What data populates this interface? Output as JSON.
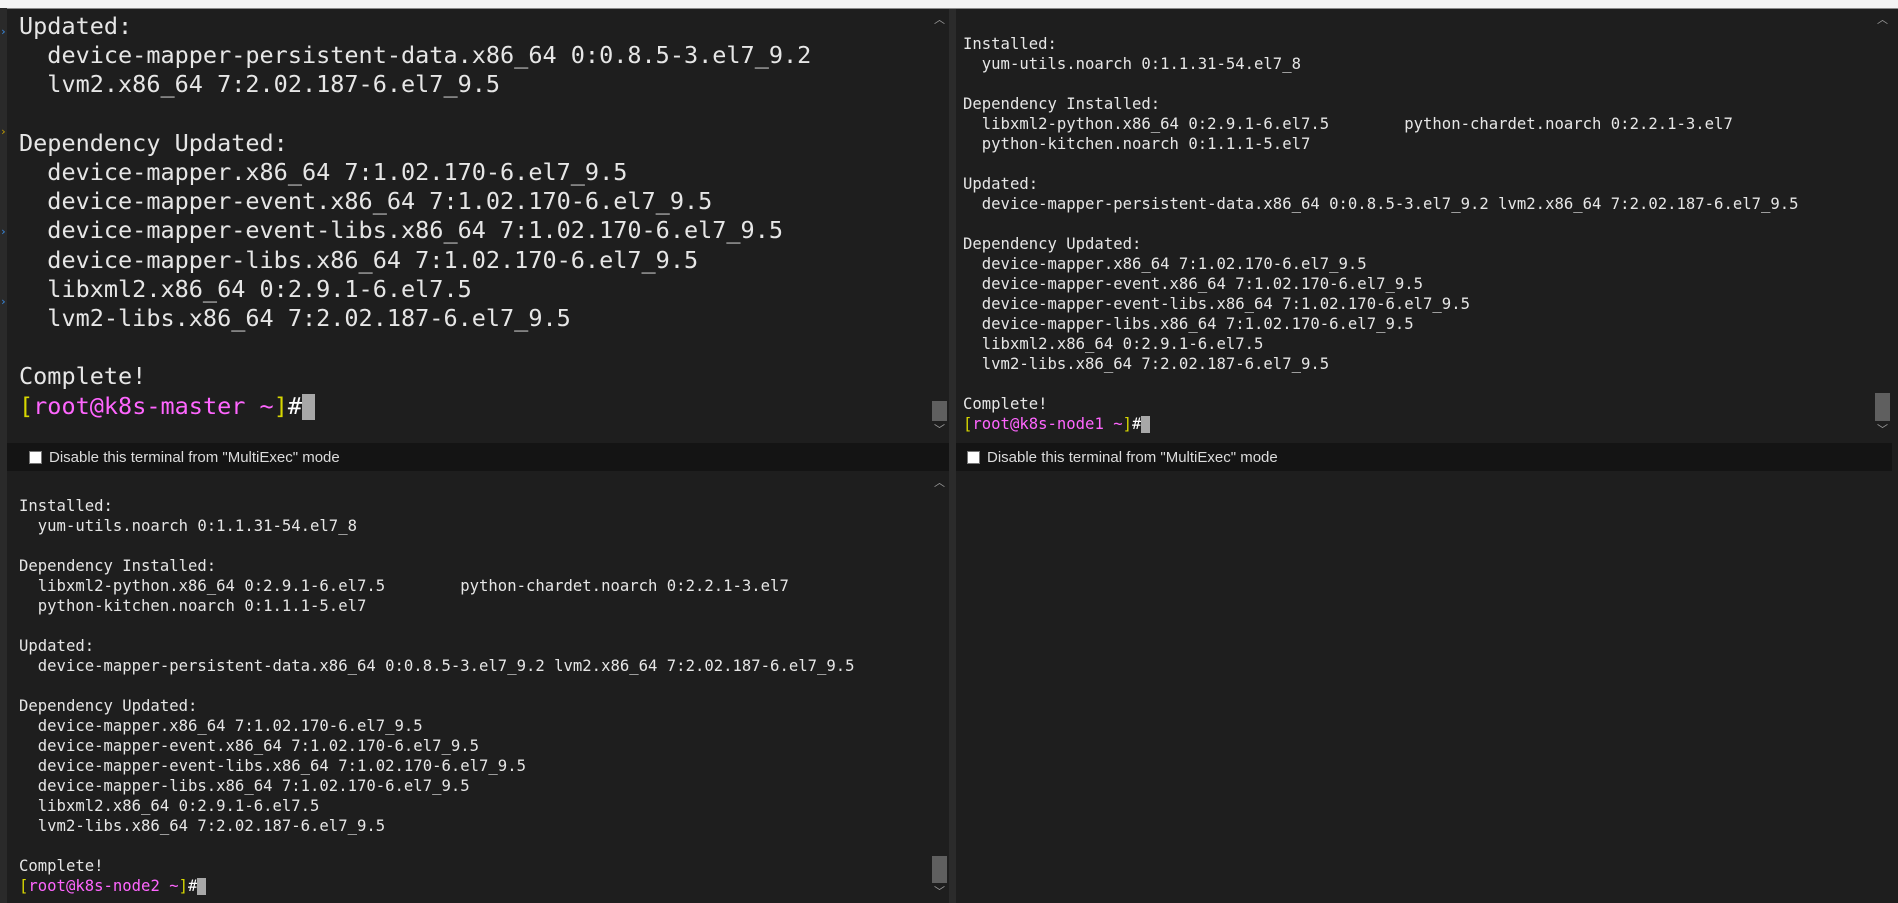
{
  "multiexec_label": "Disable this terminal from \"MultiExec\" mode",
  "panes": {
    "master": {
      "lines": [
        "Updated:",
        "  device-mapper-persistent-data.x86_64 0:0.8.5-3.el7_9.2",
        "  lvm2.x86_64 7:2.02.187-6.el7_9.5",
        "",
        "Dependency Updated:",
        "  device-mapper.x86_64 7:1.02.170-6.el7_9.5",
        "  device-mapper-event.x86_64 7:1.02.170-6.el7_9.5",
        "  device-mapper-event-libs.x86_64 7:1.02.170-6.el7_9.5",
        "  device-mapper-libs.x86_64 7:1.02.170-6.el7_9.5",
        "  libxml2.x86_64 0:2.9.1-6.el7.5",
        "  lvm2-libs.x86_64 7:2.02.187-6.el7_9.5",
        "",
        "Complete!"
      ],
      "prompt": {
        "open": "[",
        "user": "root",
        "at": "@",
        "host": "k8s-master",
        "tilde": " ~",
        "close": "]",
        "hash": "#"
      }
    },
    "node1": {
      "lines": [
        "Installed:",
        "  yum-utils.noarch 0:1.1.31-54.el7_8",
        "",
        "Dependency Installed:",
        "  libxml2-python.x86_64 0:2.9.1-6.el7.5        python-chardet.noarch 0:2.2.1-3.el7",
        "  python-kitchen.noarch 0:1.1.1-5.el7",
        "",
        "Updated:",
        "  device-mapper-persistent-data.x86_64 0:0.8.5-3.el7_9.2 lvm2.x86_64 7:2.02.187-6.el7_9.5",
        "",
        "Dependency Updated:",
        "  device-mapper.x86_64 7:1.02.170-6.el7_9.5",
        "  device-mapper-event.x86_64 7:1.02.170-6.el7_9.5",
        "  device-mapper-event-libs.x86_64 7:1.02.170-6.el7_9.5",
        "  device-mapper-libs.x86_64 7:1.02.170-6.el7_9.5",
        "  libxml2.x86_64 0:2.9.1-6.el7.5",
        "  lvm2-libs.x86_64 7:2.02.187-6.el7_9.5",
        "",
        "Complete!"
      ],
      "prompt": {
        "open": "[",
        "user": "root",
        "at": "@",
        "host": "k8s-node1",
        "tilde": " ~",
        "close": "]",
        "hash": "#"
      }
    },
    "node2": {
      "lines": [
        "Installed:",
        "  yum-utils.noarch 0:1.1.31-54.el7_8",
        "",
        "Dependency Installed:",
        "  libxml2-python.x86_64 0:2.9.1-6.el7.5        python-chardet.noarch 0:2.2.1-3.el7",
        "  python-kitchen.noarch 0:1.1.1-5.el7",
        "",
        "Updated:",
        "  device-mapper-persistent-data.x86_64 0:0.8.5-3.el7_9.2 lvm2.x86_64 7:2.02.187-6.el7_9.5",
        "",
        "Dependency Updated:",
        "  device-mapper.x86_64 7:1.02.170-6.el7_9.5",
        "  device-mapper-event.x86_64 7:1.02.170-6.el7_9.5",
        "  device-mapper-event-libs.x86_64 7:1.02.170-6.el7_9.5",
        "  device-mapper-libs.x86_64 7:1.02.170-6.el7_9.5",
        "  libxml2.x86_64 0:2.9.1-6.el7.5",
        "  lvm2-libs.x86_64 7:2.02.187-6.el7_9.5",
        "",
        "Complete!"
      ],
      "prompt": {
        "open": "[",
        "user": "root",
        "at": "@",
        "host": "k8s-node2",
        "tilde": " ~",
        "close": "]",
        "hash": "#"
      }
    },
    "node3": {
      "lines": []
    }
  },
  "colors": {
    "background": "#1e1e1e",
    "text": "#e6e6e6",
    "prompt_bracket": "#d7d700",
    "prompt_user_host": "#ff66ff",
    "cursor": "#a8a8a8"
  },
  "icons": {
    "scroll_up": "chevron-up-icon",
    "scroll_down": "chevron-down-icon",
    "checkbox": "checkbox-icon"
  }
}
